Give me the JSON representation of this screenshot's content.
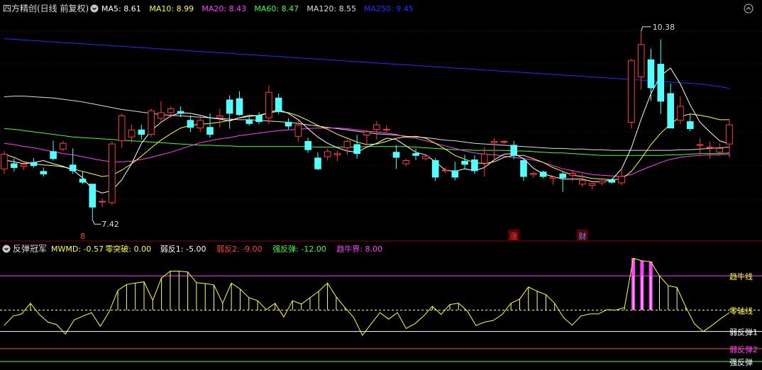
{
  "main_panel": {
    "title": "四方精创(日线 前复权)",
    "ma_legend": [
      {
        "label": "MA5: 8.61",
        "color": "#ffffff"
      },
      {
        "label": "MA10: 8.99",
        "color": "#ffff40"
      },
      {
        "label": "MA20: 8.43",
        "color": "#ff40ff"
      },
      {
        "label": "MA60: 8.47",
        "color": "#40ff40"
      },
      {
        "label": "MA120: 8.55",
        "color": "#dddddd"
      },
      {
        "label": "MA250: 9.45",
        "color": "#2a2aff"
      }
    ],
    "high_label": "10.38",
    "low_label": "7.42",
    "markers": [
      {
        "text": "8",
        "color": "#ff4040",
        "index": 8
      },
      {
        "text": "涨",
        "color": "#ff4040",
        "index": 52
      },
      {
        "text": "财",
        "color": "#40a0ff",
        "index": 59
      }
    ],
    "collapse_icon": "chevron-up-icon",
    "settings_icon": "gear-icon"
  },
  "indicator_panel": {
    "title": "反弹冠军",
    "legend": [
      {
        "label": "MWMD: -0.57",
        "color": "#ffff40"
      },
      {
        "label": "零突破: 0.00",
        "color": "#ffff40"
      },
      {
        "label": "弱反1: -5.00",
        "color": "#ffffff"
      },
      {
        "label": "弱反2: -9.00",
        "color": "#ff4040"
      },
      {
        "label": "强反弹: -12.00",
        "color": "#40ff40"
      },
      {
        "label": "趋牛界: 8.00",
        "color": "#ff40ff"
      }
    ],
    "line_labels": [
      {
        "text": "趋牛线",
        "color": "#ffff40",
        "value": 8
      },
      {
        "text": "零轴线",
        "color": "#ffff40",
        "value": 0
      },
      {
        "text": "弱反弹1",
        "color": "#ffffff",
        "value": -5
      },
      {
        "text": "弱反弹2",
        "color": "#ff40ff",
        "value": -9
      },
      {
        "text": "强反弹",
        "color": "#ffffff",
        "value": -12
      }
    ]
  },
  "chart_data": [
    {
      "type": "candlestick",
      "title": "四方精创(日线 前复权)",
      "ylim": [
        7.2,
        10.6
      ],
      "ohlc": [
        [
          8.22,
          8.5,
          8.14,
          8.45
        ],
        [
          8.3,
          8.38,
          8.18,
          8.24
        ],
        [
          8.26,
          8.33,
          8.2,
          8.29
        ],
        [
          8.32,
          8.39,
          8.24,
          8.27
        ],
        [
          8.18,
          8.24,
          8.1,
          8.14
        ],
        [
          8.49,
          8.66,
          8.35,
          8.38
        ],
        [
          8.53,
          8.66,
          8.5,
          8.62
        ],
        [
          8.28,
          8.54,
          8.14,
          8.19
        ],
        [
          8.06,
          8.18,
          7.98,
          8.01
        ],
        [
          7.98,
          7.98,
          7.42,
          7.62
        ],
        [
          7.7,
          7.76,
          7.62,
          7.71
        ],
        [
          7.69,
          8.65,
          7.65,
          8.61
        ],
        [
          8.66,
          9.09,
          8.55,
          9.05
        ],
        [
          8.72,
          8.91,
          8.63,
          8.83
        ],
        [
          8.83,
          8.91,
          8.68,
          8.76
        ],
        [
          8.76,
          9.16,
          8.72,
          9.13
        ],
        [
          9.01,
          9.28,
          8.97,
          9.1
        ],
        [
          9.1,
          9.2,
          9.02,
          9.16
        ],
        [
          9.12,
          9.2,
          9.03,
          9.09
        ],
        [
          8.98,
          9.06,
          8.8,
          8.87
        ],
        [
          8.86,
          9.05,
          8.8,
          8.98
        ],
        [
          8.87,
          9.09,
          8.71,
          8.76
        ],
        [
          9.02,
          9.16,
          8.87,
          9.05
        ],
        [
          9.3,
          9.37,
          8.85,
          9.09
        ],
        [
          9.32,
          9.44,
          9.05,
          9.07
        ],
        [
          8.99,
          9.05,
          8.9,
          8.93
        ],
        [
          9.05,
          9.11,
          8.92,
          8.96
        ],
        [
          9.02,
          9.53,
          8.92,
          9.42
        ],
        [
          9.33,
          9.4,
          9.08,
          9.12
        ],
        [
          8.95,
          9.01,
          8.84,
          8.89
        ],
        [
          8.73,
          8.99,
          8.65,
          8.91
        ],
        [
          8.65,
          8.71,
          8.47,
          8.52
        ],
        [
          8.39,
          8.48,
          8.2,
          8.22
        ],
        [
          8.41,
          8.54,
          8.35,
          8.49
        ],
        [
          8.44,
          8.51,
          8.34,
          8.46
        ],
        [
          8.55,
          8.68,
          8.44,
          8.65
        ],
        [
          8.6,
          8.75,
          8.38,
          8.46
        ],
        [
          8.75,
          8.83,
          8.59,
          8.8
        ],
        [
          8.84,
          8.97,
          8.68,
          8.91
        ],
        [
          8.83,
          8.9,
          8.8,
          8.84
        ],
        [
          8.48,
          8.59,
          8.22,
          8.4
        ],
        [
          8.3,
          8.38,
          8.26,
          8.35
        ],
        [
          8.46,
          8.54,
          8.36,
          8.43
        ],
        [
          8.38,
          8.45,
          8.35,
          8.42
        ],
        [
          8.35,
          8.39,
          8.03,
          8.09
        ],
        [
          8.19,
          8.24,
          8.16,
          8.2
        ],
        [
          8.19,
          8.33,
          8.04,
          8.09
        ],
        [
          8.34,
          8.44,
          8.21,
          8.29
        ],
        [
          8.36,
          8.43,
          8.14,
          8.19
        ],
        [
          8.31,
          8.56,
          8.1,
          8.45
        ],
        [
          8.63,
          8.7,
          8.33,
          8.65
        ],
        [
          8.65,
          8.67,
          8.61,
          8.65
        ],
        [
          8.59,
          8.66,
          8.37,
          8.43
        ],
        [
          8.35,
          8.37,
          8.03,
          8.1
        ],
        [
          8.13,
          8.18,
          8.08,
          8.15
        ],
        [
          8.17,
          8.19,
          8.07,
          8.1
        ],
        [
          8.07,
          8.1,
          7.97,
          8.09
        ],
        [
          8.14,
          8.18,
          7.86,
          8.08
        ],
        [
          8.12,
          8.2,
          8.02,
          8.15
        ],
        [
          7.98,
          8.14,
          7.94,
          8.04
        ],
        [
          7.96,
          8.0,
          7.9,
          7.99
        ],
        [
          8.0,
          8.04,
          7.96,
          8.03
        ],
        [
          8.04,
          8.07,
          7.99,
          8.01
        ],
        [
          8.0,
          8.2,
          7.96,
          8.1
        ],
        [
          8.95,
          9.94,
          8.85,
          9.92
        ],
        [
          9.66,
          10.38,
          9.46,
          10.17
        ],
        [
          9.93,
          10.1,
          9.29,
          9.49
        ],
        [
          9.86,
          10.25,
          9.08,
          9.28
        ],
        [
          9.4,
          9.56,
          8.89,
          8.86
        ],
        [
          8.98,
          9.36,
          8.92,
          9.2
        ],
        [
          8.96,
          9.08,
          8.81,
          8.85
        ],
        [
          8.6,
          8.7,
          8.44,
          8.6
        ],
        [
          8.55,
          8.65,
          8.38,
          8.56
        ],
        [
          8.48,
          8.62,
          8.43,
          8.54
        ],
        [
          8.61,
          8.99,
          8.4,
          8.91
        ]
      ],
      "series": [
        {
          "name": "MA250",
          "color": "#2a2aff",
          "values": [
            10.26,
            10.25,
            10.24,
            10.23,
            10.22,
            10.21,
            10.2,
            10.19,
            10.18,
            10.17,
            10.16,
            10.15,
            10.14,
            10.13,
            10.12,
            10.11,
            10.1,
            10.09,
            10.08,
            10.07,
            10.06,
            10.05,
            10.04,
            10.03,
            10.02,
            10.01,
            10.0,
            9.99,
            9.98,
            9.97,
            9.96,
            9.95,
            9.94,
            9.93,
            9.92,
            9.91,
            9.9,
            9.89,
            9.88,
            9.87,
            9.86,
            9.85,
            9.84,
            9.83,
            9.82,
            9.81,
            9.8,
            9.79,
            9.78,
            9.77,
            9.76,
            9.75,
            9.74,
            9.73,
            9.72,
            9.71,
            9.7,
            9.69,
            9.68,
            9.67,
            9.66,
            9.65,
            9.64,
            9.63,
            9.62,
            9.61,
            9.6,
            9.59,
            9.58,
            9.57,
            9.56,
            9.55,
            9.53,
            9.51,
            9.48
          ]
        },
        {
          "name": "MA120",
          "color": "#dddddd",
          "values": [
            9.35,
            9.36,
            9.36,
            9.35,
            9.34,
            9.33,
            9.31,
            9.29,
            9.27,
            9.24,
            9.21,
            9.18,
            9.15,
            9.13,
            9.11,
            9.09,
            9.07,
            9.06,
            9.05,
            9.04,
            9.03,
            9.02,
            9.01,
            9.0,
            8.99,
            8.99,
            8.98,
            8.97,
            8.96,
            8.95,
            8.93,
            8.91,
            8.89,
            8.87,
            8.85,
            8.83,
            8.81,
            8.79,
            8.77,
            8.76,
            8.75,
            8.73,
            8.72,
            8.71,
            8.69,
            8.67,
            8.66,
            8.64,
            8.62,
            8.61,
            8.6,
            8.59,
            8.58,
            8.57,
            8.56,
            8.55,
            8.54,
            8.54,
            8.53,
            8.53,
            8.52,
            8.52,
            8.51,
            8.51,
            8.51,
            8.51,
            8.51,
            8.51,
            8.51,
            8.52,
            8.52,
            8.53,
            8.54,
            8.55,
            8.56
          ]
        },
        {
          "name": "MA60",
          "color": "#40ff40",
          "values": [
            8.85,
            8.84,
            8.82,
            8.8,
            8.78,
            8.76,
            8.74,
            8.72,
            8.71,
            8.7,
            8.69,
            8.68,
            8.67,
            8.66,
            8.65,
            8.64,
            8.63,
            8.62,
            8.61,
            8.6,
            8.59,
            8.59,
            8.58,
            8.58,
            8.57,
            8.57,
            8.57,
            8.57,
            8.57,
            8.57,
            8.57,
            8.57,
            8.56,
            8.56,
            8.56,
            8.56,
            8.56,
            8.57,
            8.57,
            8.57,
            8.57,
            8.57,
            8.56,
            8.55,
            8.54,
            8.53,
            8.52,
            8.52,
            8.51,
            8.51,
            8.51,
            8.51,
            8.5,
            8.5,
            8.49,
            8.48,
            8.47,
            8.47,
            8.46,
            8.45,
            8.44,
            8.43,
            8.43,
            8.43,
            8.43,
            8.43,
            8.43,
            8.43,
            8.44,
            8.44,
            8.45,
            8.46,
            8.46,
            8.46,
            8.47
          ]
        },
        {
          "name": "MA20",
          "color": "#ff40ff",
          "values": [
            8.62,
            8.6,
            8.57,
            8.55,
            8.52,
            8.49,
            8.46,
            8.44,
            8.41,
            8.38,
            8.35,
            8.33,
            8.33,
            8.34,
            8.37,
            8.4,
            8.44,
            8.48,
            8.53,
            8.58,
            8.63,
            8.66,
            8.69,
            8.71,
            8.74,
            8.76,
            8.78,
            8.8,
            8.82,
            8.83,
            8.84,
            8.85,
            8.86,
            8.86,
            8.86,
            8.85,
            8.83,
            8.81,
            8.8,
            8.78,
            8.76,
            8.72,
            8.7,
            8.66,
            8.62,
            8.58,
            8.54,
            8.5,
            8.47,
            8.45,
            8.44,
            8.42,
            8.4,
            8.38,
            8.36,
            8.32,
            8.27,
            8.22,
            8.19,
            8.16,
            8.13,
            8.12,
            8.11,
            8.1,
            8.13,
            8.2,
            8.26,
            8.32,
            8.37,
            8.4,
            8.42,
            8.43,
            8.44,
            8.44,
            8.45
          ]
        },
        {
          "name": "MA10",
          "color": "#ffff40",
          "values": [
            8.45,
            8.4,
            8.33,
            8.3,
            8.28,
            8.27,
            8.25,
            8.22,
            8.18,
            8.14,
            8.1,
            8.12,
            8.2,
            8.3,
            8.42,
            8.55,
            8.67,
            8.77,
            8.86,
            8.9,
            8.92,
            8.93,
            8.95,
            8.98,
            9.02,
            9.04,
            9.06,
            9.1,
            9.12,
            9.1,
            9.05,
            8.98,
            8.9,
            8.84,
            8.76,
            8.7,
            8.64,
            8.6,
            8.61,
            8.65,
            8.7,
            8.72,
            8.73,
            8.7,
            8.62,
            8.53,
            8.43,
            8.37,
            8.32,
            8.3,
            8.33,
            8.4,
            8.43,
            8.43,
            8.38,
            8.32,
            8.24,
            8.18,
            8.12,
            8.1,
            8.07,
            8.06,
            8.05,
            8.06,
            8.18,
            8.38,
            8.6,
            8.78,
            8.92,
            9.04,
            9.08,
            9.06,
            9.03,
            8.99,
            8.99
          ]
        },
        {
          "name": "MA5",
          "color": "#ffffff",
          "values": [
            8.36,
            8.33,
            8.3,
            8.32,
            8.35,
            8.3,
            8.26,
            8.2,
            8.08,
            7.9,
            7.84,
            7.88,
            8.05,
            8.3,
            8.62,
            8.82,
            8.95,
            9.05,
            9.1,
            9.09,
            9.06,
            9.02,
            9.0,
            8.97,
            9.02,
            9.06,
            9.05,
            9.1,
            9.15,
            9.09,
            8.99,
            8.85,
            8.72,
            8.62,
            8.55,
            8.5,
            8.48,
            8.56,
            8.62,
            8.7,
            8.68,
            8.58,
            8.48,
            8.44,
            8.33,
            8.2,
            8.18,
            8.22,
            8.19,
            8.24,
            8.36,
            8.45,
            8.46,
            8.38,
            8.23,
            8.14,
            8.1,
            8.06,
            8.06,
            8.06,
            8.02,
            8.02,
            8.05,
            8.22,
            8.55,
            9.0,
            9.4,
            9.68,
            9.8,
            9.55,
            9.22,
            8.95,
            8.8,
            8.66,
            8.61
          ]
        }
      ]
    },
    {
      "type": "line",
      "title": "反弹冠军",
      "ylim": [
        -13,
        12.5
      ],
      "series": [
        {
          "name": "MWMD",
          "color": "#ffff40",
          "values": [
            -3.6,
            -1.4,
            -0.9,
            1.6,
            -1.0,
            -2.8,
            -3.4,
            -5.6,
            -2.3,
            -1.4,
            -0.6,
            -3.8,
            -0.4,
            4.6,
            6.0,
            6.3,
            6.6,
            2.3,
            7.5,
            9.1,
            9.1,
            8.9,
            6.4,
            6.2,
            5.9,
            1.6,
            6.3,
            4.9,
            2.9,
            2.2,
            0.1,
            1.6,
            -1.6,
            2.2,
            1.4,
            2.9,
            4.4,
            6.3,
            3.1,
            0.6,
            -1.7,
            -5.9,
            -3.2,
            -0.6,
            -2.1,
            -0.6,
            -4.3,
            -3.2,
            -1.4,
            0.9,
            -1.0,
            1.3,
            1.6,
            -0.2,
            -3.6,
            -2.8,
            -2.4,
            -1.0,
            1.6,
            2.6,
            5.4,
            4.4,
            3.6,
            1.6,
            -1.7,
            -3.5,
            -1.4,
            -0.9,
            -0.9,
            0.1,
            0.0,
            0.6,
            12.1,
            11.5,
            11.3,
            8.0,
            5.7,
            5.3,
            0.8,
            -3.2,
            -5.0,
            -3.6,
            -2.0,
            -0.6
          ]
        }
      ],
      "reference_lines": [
        {
          "name": "趋牛界",
          "value": 8,
          "color": "#ff40ff"
        },
        {
          "name": "零突破",
          "value": 0,
          "color": "#ffff40"
        },
        {
          "name": "弱反1",
          "value": -5,
          "color": "#ffffff"
        },
        {
          "name": "弱反2",
          "value": -9,
          "color": "#ff4040"
        },
        {
          "name": "强反弹",
          "value": -12,
          "color": "#40ff40"
        }
      ]
    }
  ]
}
